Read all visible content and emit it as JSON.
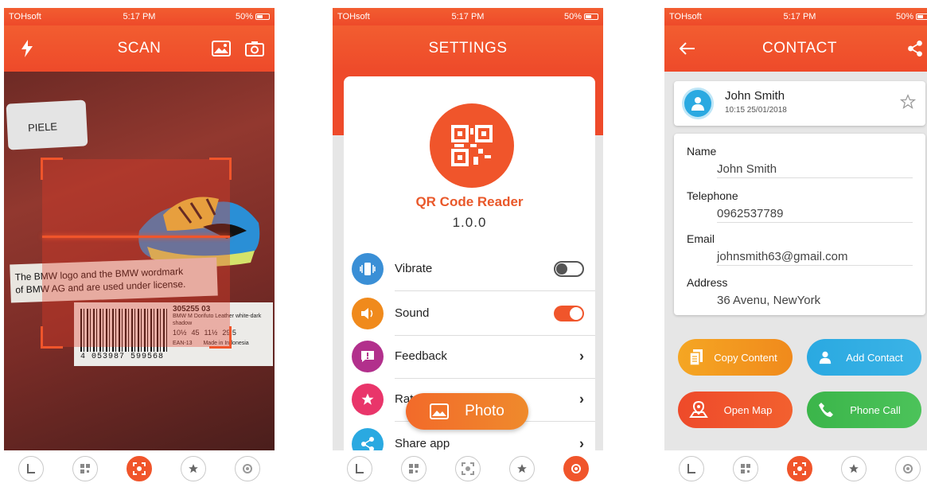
{
  "status": {
    "carrier": "TOHsoft",
    "time": "5:17 PM",
    "battery": "50%"
  },
  "scan": {
    "title": "SCAN",
    "paper_label": "PIELE",
    "label_line1": "The BMW logo and the BMW wordmark",
    "label_line2": "of BMW AG and are used under license.",
    "barcode_number": "4 053987 599568",
    "product_code": "305255 03",
    "product_desc": "BMW M Dorifuto Leather white-dark shadow",
    "size_uk": "10½",
    "size_eur": "45",
    "size_us": "11½",
    "size_cm": "29.5",
    "made_in": "Made in Indonesia",
    "barcode_type": "EAN-13"
  },
  "settings": {
    "title": "SETTINGS",
    "app_name": "QR Code Reader",
    "version": "1.0.0",
    "items": [
      {
        "label": "Vibrate",
        "color": "#3a8fd6",
        "control": "toggle",
        "on": false
      },
      {
        "label": "Sound",
        "color": "#f08a1c",
        "control": "toggle",
        "on": true
      },
      {
        "label": "Feedback",
        "color": "#b2308c",
        "control": "chevron"
      },
      {
        "label": "Rate app",
        "color": "#e9356a",
        "control": "chevron"
      },
      {
        "label": "Share app",
        "color": "#2aa9e1",
        "control": "chevron"
      }
    ],
    "photo_label": "Photo"
  },
  "contact": {
    "title": "CONTACT",
    "name": "John Smith",
    "timestamp": "10:15 25/01/2018",
    "fields": [
      {
        "key": "Name",
        "value": "John Smith"
      },
      {
        "key": "Telephone",
        "value": "0962537789"
      },
      {
        "key": "Email",
        "value": "johnsmith63@gmail.com"
      },
      {
        "key": "Address",
        "value": "36 Avenu, NewYork"
      }
    ],
    "actions": [
      {
        "label": "Copy Content",
        "color": "#f5a623"
      },
      {
        "label": "Add Contact",
        "color": "#2aa9e1"
      },
      {
        "label": "Open Map",
        "color": "#ee4a2a"
      },
      {
        "label": "Phone Call",
        "color": "#3bb54a"
      }
    ]
  },
  "tabbar": {
    "icons": [
      "history-icon",
      "qr-generate-icon",
      "scan-icon",
      "favorite-icon",
      "settings-icon"
    ]
  }
}
